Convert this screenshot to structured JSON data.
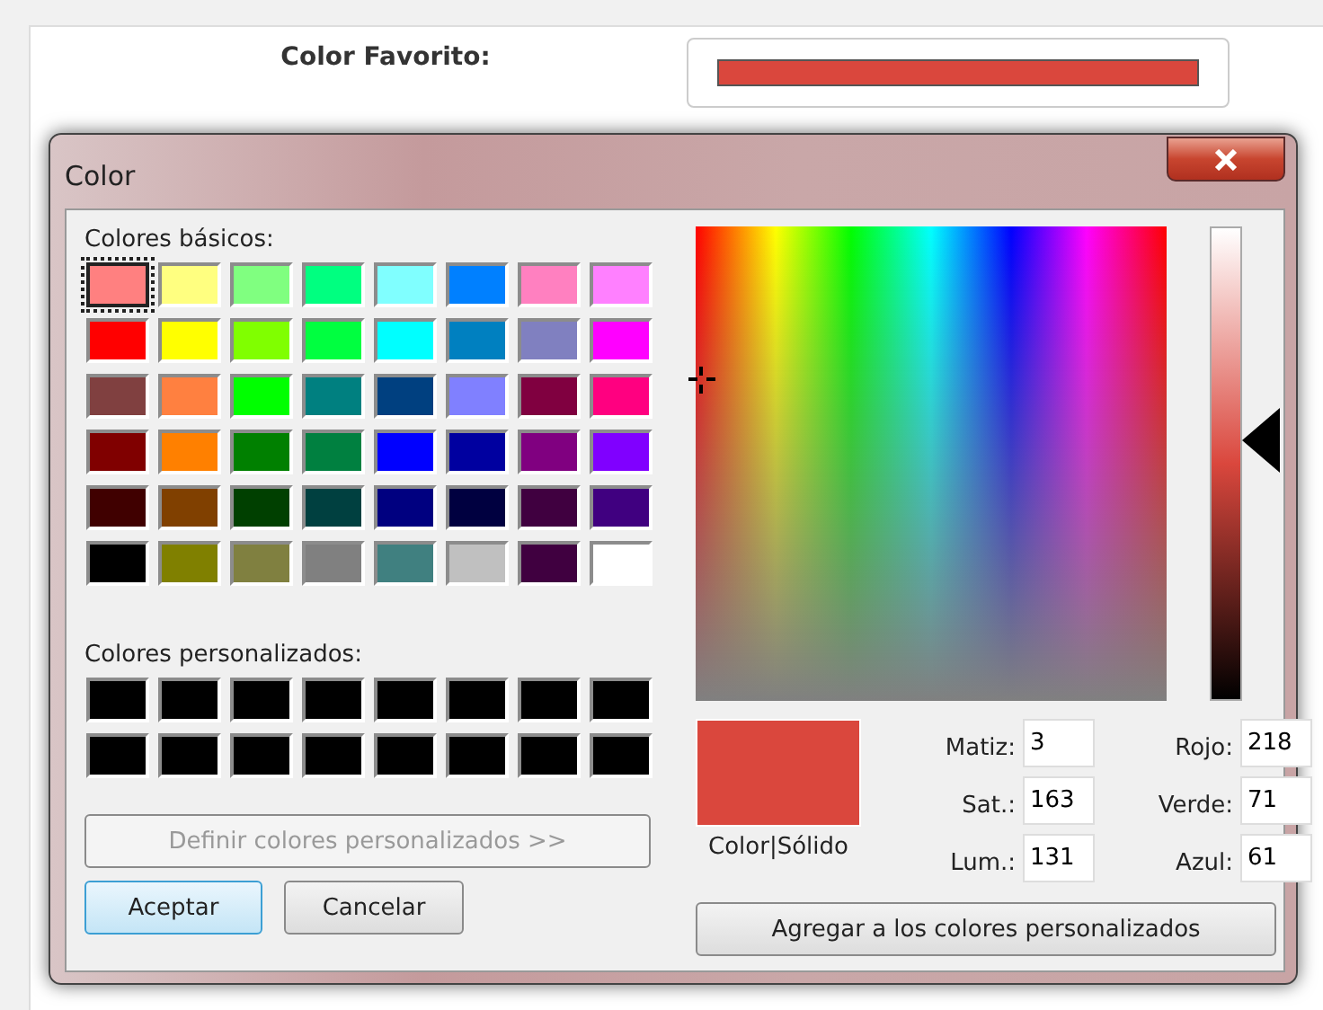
{
  "form": {
    "label": "Color Favorito:",
    "color": "#da473d"
  },
  "dialog": {
    "title": "Color",
    "basic_label": "Colores básicos:",
    "basic_colors": [
      {
        "color": "#ff8080",
        "selected": true
      },
      {
        "color": "#ffff80",
        "selected": false
      },
      {
        "color": "#80ff80",
        "selected": false
      },
      {
        "color": "#00ff80",
        "selected": false
      },
      {
        "color": "#80ffff",
        "selected": false
      },
      {
        "color": "#0080ff",
        "selected": false
      },
      {
        "color": "#ff80c0",
        "selected": false
      },
      {
        "color": "#ff80ff",
        "selected": false
      },
      {
        "color": "#ff0000",
        "selected": false
      },
      {
        "color": "#ffff00",
        "selected": false
      },
      {
        "color": "#80ff00",
        "selected": false
      },
      {
        "color": "#00ff40",
        "selected": false
      },
      {
        "color": "#00ffff",
        "selected": false
      },
      {
        "color": "#0080c0",
        "selected": false
      },
      {
        "color": "#8080c0",
        "selected": false
      },
      {
        "color": "#ff00ff",
        "selected": false
      },
      {
        "color": "#804040",
        "selected": false
      },
      {
        "color": "#ff8040",
        "selected": false
      },
      {
        "color": "#00ff00",
        "selected": false
      },
      {
        "color": "#008080",
        "selected": false
      },
      {
        "color": "#004080",
        "selected": false
      },
      {
        "color": "#8080ff",
        "selected": false
      },
      {
        "color": "#800040",
        "selected": false
      },
      {
        "color": "#ff0080",
        "selected": false
      },
      {
        "color": "#800000",
        "selected": false
      },
      {
        "color": "#ff8000",
        "selected": false
      },
      {
        "color": "#008000",
        "selected": false
      },
      {
        "color": "#008040",
        "selected": false
      },
      {
        "color": "#0000ff",
        "selected": false
      },
      {
        "color": "#0000a0",
        "selected": false
      },
      {
        "color": "#800080",
        "selected": false
      },
      {
        "color": "#8000ff",
        "selected": false
      },
      {
        "color": "#400000",
        "selected": false
      },
      {
        "color": "#804000",
        "selected": false
      },
      {
        "color": "#004000",
        "selected": false
      },
      {
        "color": "#004040",
        "selected": false
      },
      {
        "color": "#000080",
        "selected": false
      },
      {
        "color": "#000040",
        "selected": false
      },
      {
        "color": "#400040",
        "selected": false
      },
      {
        "color": "#400080",
        "selected": false
      },
      {
        "color": "#000000",
        "selected": false
      },
      {
        "color": "#808000",
        "selected": false
      },
      {
        "color": "#808040",
        "selected": false
      },
      {
        "color": "#808080",
        "selected": false
      },
      {
        "color": "#408080",
        "selected": false
      },
      {
        "color": "#c0c0c0",
        "selected": false
      },
      {
        "color": "#400040",
        "selected": false
      },
      {
        "color": "#ffffff",
        "selected": false
      }
    ],
    "custom_label": "Colores personalizados:",
    "custom_colors": [
      {
        "color": "#000000"
      },
      {
        "color": "#000000"
      },
      {
        "color": "#000000"
      },
      {
        "color": "#000000"
      },
      {
        "color": "#000000"
      },
      {
        "color": "#000000"
      },
      {
        "color": "#000000"
      },
      {
        "color": "#000000"
      },
      {
        "color": "#000000"
      },
      {
        "color": "#000000"
      },
      {
        "color": "#000000"
      },
      {
        "color": "#000000"
      },
      {
        "color": "#000000"
      },
      {
        "color": "#000000"
      },
      {
        "color": "#000000"
      },
      {
        "color": "#000000"
      }
    ],
    "define_button": {
      "label": "Definir colores personalizados >>",
      "disabled": true
    },
    "ok_button": "Aceptar",
    "cancel_button": "Cancelar",
    "lum_slider": {
      "level": 0.55
    },
    "preview": {
      "color": "#da473d",
      "label": "Color|Sólido"
    },
    "fields": [
      {
        "label": "Matiz:",
        "value": "3"
      },
      {
        "label": "Rojo:",
        "value": "218"
      },
      {
        "label": "Sat.:",
        "value": "163"
      },
      {
        "label": "Verde:",
        "value": "71"
      },
      {
        "label": "Lum.:",
        "value": "131"
      },
      {
        "label": "Azul:",
        "value": "61"
      }
    ],
    "add_button": "Agregar a los colores personalizados"
  }
}
